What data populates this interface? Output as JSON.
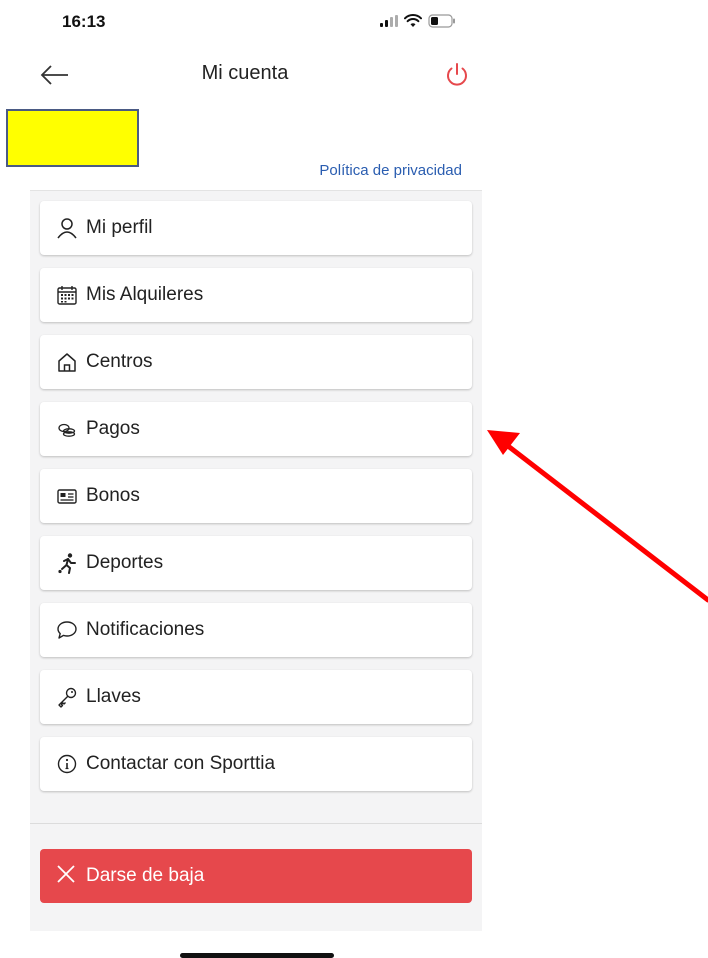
{
  "status_bar": {
    "time": "16:13"
  },
  "header": {
    "title": "Mi cuenta"
  },
  "privacy_link": "Política de privacidad",
  "menu": {
    "items": [
      {
        "label": "Mi perfil",
        "icon": "user-icon"
      },
      {
        "label": "Mis Alquileres",
        "icon": "calendar-icon"
      },
      {
        "label": "Centros",
        "icon": "home-icon"
      },
      {
        "label": "Pagos",
        "icon": "coins-icon"
      },
      {
        "label": "Bonos",
        "icon": "card-icon"
      },
      {
        "label": "Deportes",
        "icon": "runner-icon"
      },
      {
        "label": "Notificaciones",
        "icon": "chat-bubble-icon"
      },
      {
        "label": "Llaves",
        "icon": "key-icon"
      },
      {
        "label": "Contactar con Sporttia",
        "icon": "info-icon"
      }
    ]
  },
  "danger": {
    "label": "Darse de baja",
    "icon": "close-icon"
  },
  "colors": {
    "accent_link": "#2a5db0",
    "danger": "#e6484c",
    "power": "#e6484c",
    "logo_placeholder": "#ffff00",
    "annotation_arrow": "#ff0000"
  }
}
